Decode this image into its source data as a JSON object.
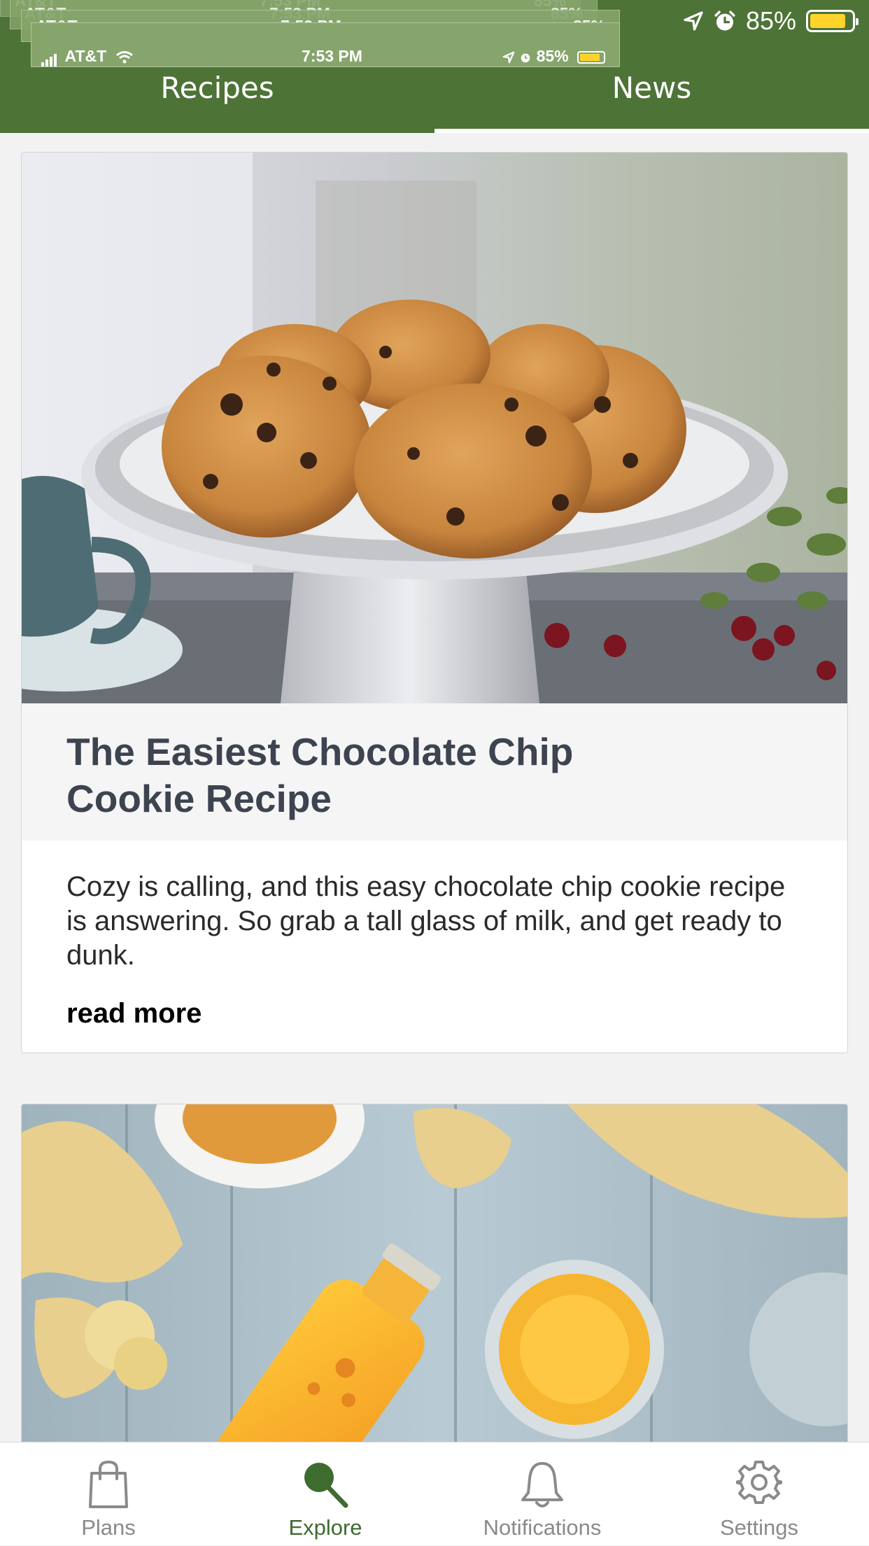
{
  "colors": {
    "header_green": "#4d7337",
    "accent_green": "#3e6b2e",
    "battery_yellow": "#ffd42a",
    "nav_inactive": "#8a8a8a"
  },
  "status_bar": {
    "carrier": "AT&T",
    "time": "7:53 PM",
    "battery": "85%",
    "ghost_battery": "85%",
    "icons": [
      "location-arrow-icon",
      "alarm-clock-icon",
      "battery-icon",
      "wifi-icon",
      "signal-icon"
    ]
  },
  "tabs": [
    {
      "label": "Recipes",
      "selected": false
    },
    {
      "label": "News",
      "selected": true
    }
  ],
  "feed": {
    "cards": [
      {
        "title": "The Easiest Chocolate Chip Cookie Recipe",
        "description": "Cozy is calling, and this easy chocolate chip cookie recipe is answering. So grab a tall glass of milk, and get ready to dunk.",
        "link_label": "read more",
        "image": "chocolate-chip-cookies-on-cake-stand-photo"
      },
      {
        "title": "",
        "image": "ginger-juice-bottle-photo"
      }
    ]
  },
  "bottom_nav": {
    "items": [
      {
        "label": "Plans",
        "icon": "shopping-bag-icon",
        "active": false
      },
      {
        "label": "Explore",
        "icon": "magnifier-icon",
        "active": true
      },
      {
        "label": "Notifications",
        "icon": "bell-icon",
        "active": false
      },
      {
        "label": "Settings",
        "icon": "gear-icon",
        "active": false
      }
    ]
  }
}
